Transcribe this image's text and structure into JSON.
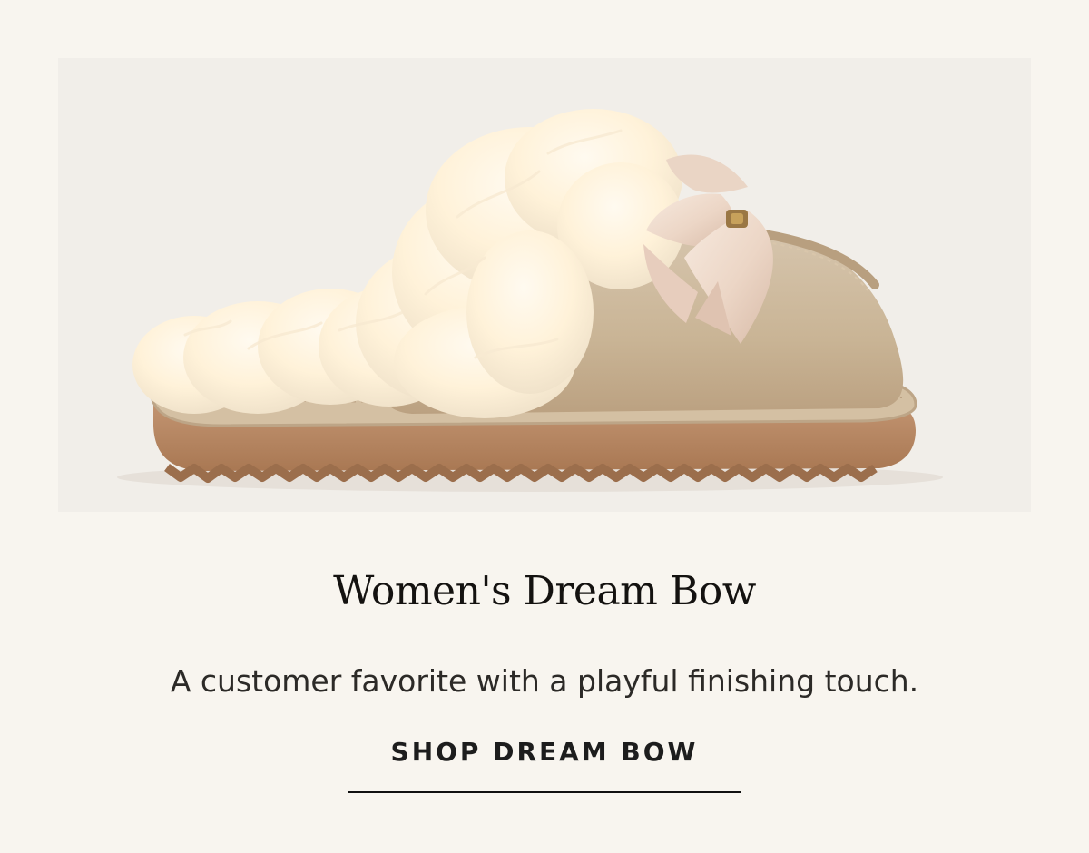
{
  "product": {
    "title": "Women's Dream Bow",
    "description": "A customer favorite with a playful finishing touch.",
    "cta_label": "SHOP DREAM BOW",
    "image_alt": "Women's Dream Bow slipper with cream sheepskin cuff and pink satin bow"
  },
  "theme": {
    "page_background": "#f8f5ef",
    "image_background": "#f1eee9",
    "suede": "#c7b49a",
    "sole": "#b58762",
    "fur": "#fff4df",
    "bow": "#eddccf"
  }
}
